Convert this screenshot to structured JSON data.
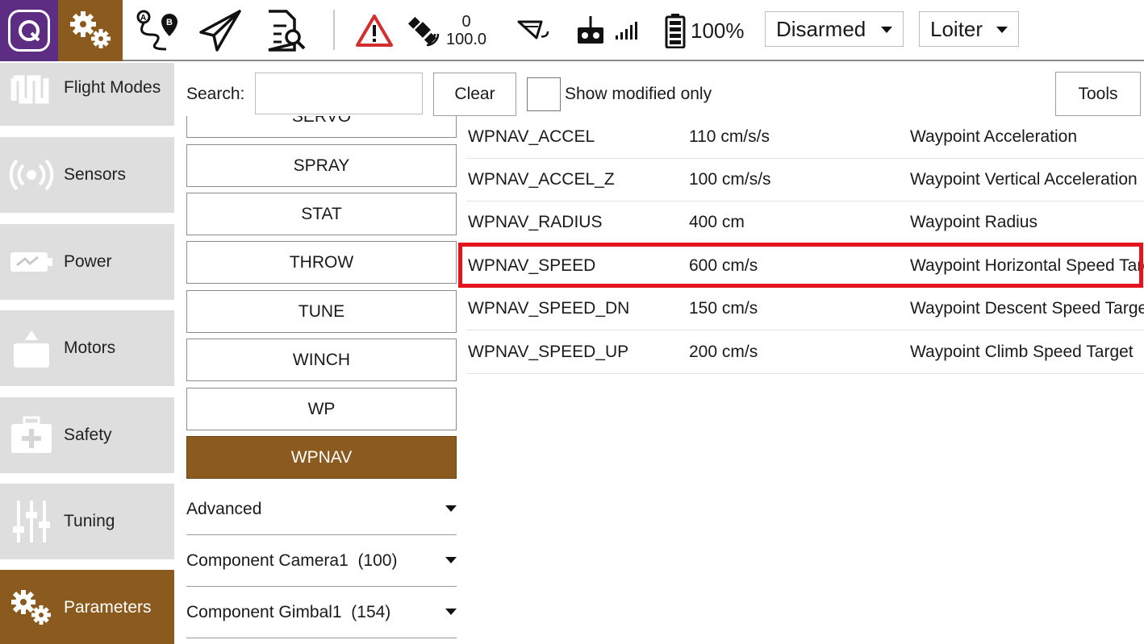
{
  "toolbar": {
    "gps_count": "0",
    "gps_hdop": "100.0",
    "battery": "100%",
    "arm_state": "Disarmed",
    "flight_mode": "Loiter"
  },
  "sidebar": {
    "items": [
      {
        "label": "Flight Modes",
        "icon": "flight-modes-icon"
      },
      {
        "label": "Sensors",
        "icon": "sensors-icon"
      },
      {
        "label": "Power",
        "icon": "power-icon"
      },
      {
        "label": "Motors",
        "icon": "motors-icon"
      },
      {
        "label": "Safety",
        "icon": "safety-icon"
      },
      {
        "label": "Tuning",
        "icon": "tuning-icon"
      },
      {
        "label": "Parameters",
        "icon": "parameters-icon"
      }
    ],
    "active": "Parameters"
  },
  "search": {
    "label": "Search:",
    "value": "",
    "clear_label": "Clear",
    "modified_label": "Show modified only",
    "tools_label": "Tools"
  },
  "groups": {
    "buttons": [
      "SERVO",
      "SPRAY",
      "STAT",
      "THROW",
      "TUNE",
      "WINCH",
      "WP",
      "WPNAV"
    ],
    "active": "WPNAV",
    "folds": [
      "Advanced",
      "Component Camera1  (100)",
      "Component Gimbal1  (154)"
    ]
  },
  "params": [
    {
      "name": "WPNAV_ACCEL",
      "value": "110 cm/s/s",
      "desc": "Waypoint Acceleration"
    },
    {
      "name": "WPNAV_ACCEL_Z",
      "value": "100 cm/s/s",
      "desc": "Waypoint Vertical Acceleration"
    },
    {
      "name": "WPNAV_RADIUS",
      "value": "400 cm",
      "desc": "Waypoint Radius"
    },
    {
      "name": "WPNAV_SPEED",
      "value": "600 cm/s",
      "desc": "Waypoint Horizontal Speed Target"
    },
    {
      "name": "WPNAV_SPEED_DN",
      "value": "150 cm/s",
      "desc": "Waypoint Descent Speed Target"
    },
    {
      "name": "WPNAV_SPEED_UP",
      "value": "200 cm/s",
      "desc": "Waypoint Climb Speed Target"
    }
  ],
  "highlighted_param": "WPNAV_SPEED",
  "colors": {
    "logo_bg": "#5c2d82",
    "accent": "#8b5a1f",
    "warning": "#d32f2f",
    "highlight_box": "#e4141f"
  }
}
